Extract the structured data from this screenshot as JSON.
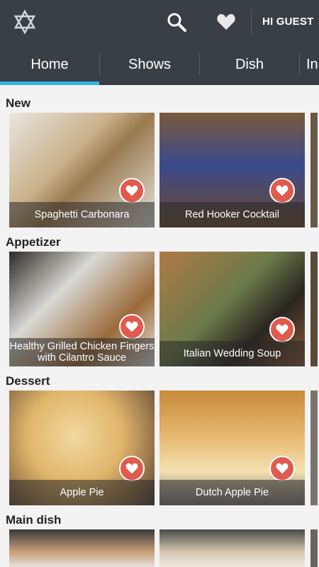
{
  "header": {
    "greeting": "HI GUEST",
    "icons": [
      "star-of-david-logo",
      "search-icon",
      "heart-icon"
    ]
  },
  "tabs": [
    {
      "label": "Home",
      "active": true
    },
    {
      "label": "Shows"
    },
    {
      "label": "Dish"
    },
    {
      "label": "In"
    }
  ],
  "sections": [
    {
      "title": "New",
      "cards": [
        {
          "caption": "Spaghetti Carbonara"
        },
        {
          "caption": "Red Hooker Cocktail"
        }
      ]
    },
    {
      "title": "Appetizer",
      "cards": [
        {
          "caption": "Healthy Grilled Chicken Fingers with Cilantro Sauce"
        },
        {
          "caption": "Italian Wedding Soup"
        }
      ]
    },
    {
      "title": "Dessert",
      "cards": [
        {
          "caption": "Apple Pie"
        },
        {
          "caption": "Dutch Apple Pie"
        }
      ]
    },
    {
      "title": "Main dish",
      "cards": [
        {
          "caption": ""
        },
        {
          "caption": ""
        }
      ]
    }
  ],
  "colors": {
    "header_bg": "#3a3f46",
    "tab_indicator": "#33b5e5",
    "favorite_button": "#e05a4e"
  }
}
